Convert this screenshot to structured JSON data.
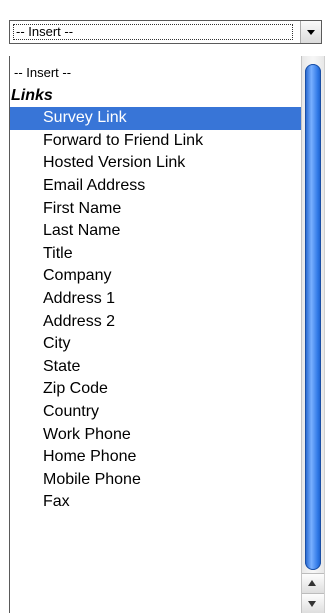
{
  "select": {
    "value": "-- Insert --",
    "arrow_icon": "chevron-down-icon"
  },
  "dropdown": {
    "placeholder": "-- Insert --",
    "group_label": "Links",
    "selected_index": 0,
    "options": [
      "Survey Link",
      "Forward to Friend Link",
      "Hosted Version Link",
      "Email Address",
      "First Name",
      "Last Name",
      "Title",
      "Company",
      "Address 1",
      "Address 2",
      "City",
      "State",
      "Zip Code",
      "Country",
      "Work Phone",
      "Home Phone",
      "Mobile Phone",
      "Fax"
    ]
  },
  "colors": {
    "selection": "#3875d7",
    "scroll_thumb": "#2f78e6"
  }
}
